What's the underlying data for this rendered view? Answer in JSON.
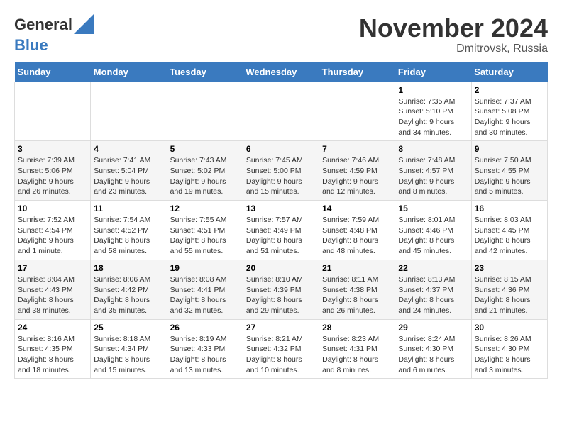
{
  "header": {
    "logo_line1": "General",
    "logo_line2": "Blue",
    "month_title": "November 2024",
    "location": "Dmitrovsk, Russia"
  },
  "weekdays": [
    "Sunday",
    "Monday",
    "Tuesday",
    "Wednesday",
    "Thursday",
    "Friday",
    "Saturday"
  ],
  "weeks": [
    [
      {
        "day": "",
        "info": ""
      },
      {
        "day": "",
        "info": ""
      },
      {
        "day": "",
        "info": ""
      },
      {
        "day": "",
        "info": ""
      },
      {
        "day": "",
        "info": ""
      },
      {
        "day": "1",
        "info": "Sunrise: 7:35 AM\nSunset: 5:10 PM\nDaylight: 9 hours and 34 minutes."
      },
      {
        "day": "2",
        "info": "Sunrise: 7:37 AM\nSunset: 5:08 PM\nDaylight: 9 hours and 30 minutes."
      }
    ],
    [
      {
        "day": "3",
        "info": "Sunrise: 7:39 AM\nSunset: 5:06 PM\nDaylight: 9 hours and 26 minutes."
      },
      {
        "day": "4",
        "info": "Sunrise: 7:41 AM\nSunset: 5:04 PM\nDaylight: 9 hours and 23 minutes."
      },
      {
        "day": "5",
        "info": "Sunrise: 7:43 AM\nSunset: 5:02 PM\nDaylight: 9 hours and 19 minutes."
      },
      {
        "day": "6",
        "info": "Sunrise: 7:45 AM\nSunset: 5:00 PM\nDaylight: 9 hours and 15 minutes."
      },
      {
        "day": "7",
        "info": "Sunrise: 7:46 AM\nSunset: 4:59 PM\nDaylight: 9 hours and 12 minutes."
      },
      {
        "day": "8",
        "info": "Sunrise: 7:48 AM\nSunset: 4:57 PM\nDaylight: 9 hours and 8 minutes."
      },
      {
        "day": "9",
        "info": "Sunrise: 7:50 AM\nSunset: 4:55 PM\nDaylight: 9 hours and 5 minutes."
      }
    ],
    [
      {
        "day": "10",
        "info": "Sunrise: 7:52 AM\nSunset: 4:54 PM\nDaylight: 9 hours and 1 minute."
      },
      {
        "day": "11",
        "info": "Sunrise: 7:54 AM\nSunset: 4:52 PM\nDaylight: 8 hours and 58 minutes."
      },
      {
        "day": "12",
        "info": "Sunrise: 7:55 AM\nSunset: 4:51 PM\nDaylight: 8 hours and 55 minutes."
      },
      {
        "day": "13",
        "info": "Sunrise: 7:57 AM\nSunset: 4:49 PM\nDaylight: 8 hours and 51 minutes."
      },
      {
        "day": "14",
        "info": "Sunrise: 7:59 AM\nSunset: 4:48 PM\nDaylight: 8 hours and 48 minutes."
      },
      {
        "day": "15",
        "info": "Sunrise: 8:01 AM\nSunset: 4:46 PM\nDaylight: 8 hours and 45 minutes."
      },
      {
        "day": "16",
        "info": "Sunrise: 8:03 AM\nSunset: 4:45 PM\nDaylight: 8 hours and 42 minutes."
      }
    ],
    [
      {
        "day": "17",
        "info": "Sunrise: 8:04 AM\nSunset: 4:43 PM\nDaylight: 8 hours and 38 minutes."
      },
      {
        "day": "18",
        "info": "Sunrise: 8:06 AM\nSunset: 4:42 PM\nDaylight: 8 hours and 35 minutes."
      },
      {
        "day": "19",
        "info": "Sunrise: 8:08 AM\nSunset: 4:41 PM\nDaylight: 8 hours and 32 minutes."
      },
      {
        "day": "20",
        "info": "Sunrise: 8:10 AM\nSunset: 4:39 PM\nDaylight: 8 hours and 29 minutes."
      },
      {
        "day": "21",
        "info": "Sunrise: 8:11 AM\nSunset: 4:38 PM\nDaylight: 8 hours and 26 minutes."
      },
      {
        "day": "22",
        "info": "Sunrise: 8:13 AM\nSunset: 4:37 PM\nDaylight: 8 hours and 24 minutes."
      },
      {
        "day": "23",
        "info": "Sunrise: 8:15 AM\nSunset: 4:36 PM\nDaylight: 8 hours and 21 minutes."
      }
    ],
    [
      {
        "day": "24",
        "info": "Sunrise: 8:16 AM\nSunset: 4:35 PM\nDaylight: 8 hours and 18 minutes."
      },
      {
        "day": "25",
        "info": "Sunrise: 8:18 AM\nSunset: 4:34 PM\nDaylight: 8 hours and 15 minutes."
      },
      {
        "day": "26",
        "info": "Sunrise: 8:19 AM\nSunset: 4:33 PM\nDaylight: 8 hours and 13 minutes."
      },
      {
        "day": "27",
        "info": "Sunrise: 8:21 AM\nSunset: 4:32 PM\nDaylight: 8 hours and 10 minutes."
      },
      {
        "day": "28",
        "info": "Sunrise: 8:23 AM\nSunset: 4:31 PM\nDaylight: 8 hours and 8 minutes."
      },
      {
        "day": "29",
        "info": "Sunrise: 8:24 AM\nSunset: 4:30 PM\nDaylight: 8 hours and 6 minutes."
      },
      {
        "day": "30",
        "info": "Sunrise: 8:26 AM\nSunset: 4:30 PM\nDaylight: 8 hours and 3 minutes."
      }
    ]
  ]
}
